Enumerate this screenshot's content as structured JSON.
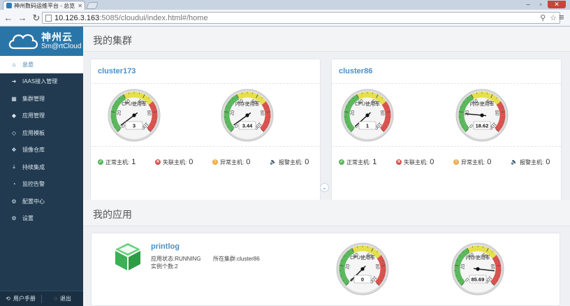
{
  "browser": {
    "tab_title": "神州数码运维平台 - 总览",
    "url_host": "10.126.3.163",
    "url_rest": ":5085/cloudui/index.html#/home"
  },
  "logo": {
    "cn": "神州云",
    "en": "Sm@rtCloud"
  },
  "sidebar": {
    "items": [
      {
        "label": "总览",
        "icon": "home-icon"
      },
      {
        "label": "IAAS接入管理",
        "icon": "login-icon"
      },
      {
        "label": "集群管理",
        "icon": "grid-icon"
      },
      {
        "label": "应用管理",
        "icon": "cube-icon"
      },
      {
        "label": "应用模板",
        "icon": "cube-outline-icon"
      },
      {
        "label": "镜像仓库",
        "icon": "cubes-icon"
      },
      {
        "label": "持续集成",
        "icon": "download-icon"
      },
      {
        "label": "监控告警",
        "icon": "gauge-icon"
      },
      {
        "label": "配置中心",
        "icon": "cogs-icon"
      },
      {
        "label": "设置",
        "icon": "gear-icon"
      }
    ],
    "footer": {
      "manual": "用户手册",
      "logout": "退出"
    }
  },
  "main": {
    "clusters_title": "我的集群",
    "apps_title": "我的应用",
    "clusters": [
      {
        "name": "cluster173",
        "cpu": {
          "label": "CPU使用率",
          "value": "3"
        },
        "mem": {
          "label": "内存使用率",
          "value": "3.44"
        },
        "stats": {
          "normal_label": "正常主机:",
          "normal": "1",
          "lost_label": "失联主机:",
          "lost": "0",
          "abnormal_label": "异常主机:",
          "abnormal": "0",
          "alarm_label": "报警主机:",
          "alarm": "0"
        }
      },
      {
        "name": "cluster86",
        "cpu": {
          "label": "CPU使用率",
          "value": "1"
        },
        "mem": {
          "label": "内存使用率",
          "value": "18.62"
        },
        "stats": {
          "normal_label": "正常主机:",
          "normal": "1",
          "lost_label": "失联主机:",
          "lost": "0",
          "abnormal_label": "异常主机:",
          "abnormal": "0",
          "alarm_label": "报警主机:",
          "alarm": "0"
        }
      }
    ],
    "app": {
      "name": "printlog",
      "status": "应用状态:RUNNING",
      "cluster": "所在集群:cluster86",
      "instances": "实例个数:2",
      "cpu": {
        "label": "CPU使用率",
        "value": "0"
      },
      "mem": {
        "label": "内存使用率",
        "value": "85.69"
      }
    }
  },
  "gauge_ticks": [
    "0",
    "20",
    "40",
    "60",
    "80",
    "100"
  ],
  "colors": {
    "sidebar": "#213a4f",
    "accent": "#2a75a8",
    "link": "#4a90c8",
    "green": "#5cb85c",
    "yellow": "#e5e04c",
    "red": "#d9534f"
  }
}
